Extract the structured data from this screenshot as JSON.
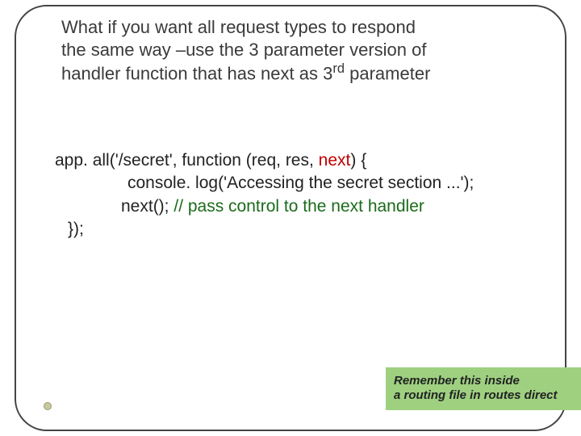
{
  "intro": {
    "t1": "What if you want all request types to respond",
    "t2": "the same way –use the 3 parameter version of",
    "t3_a": "handler function that has next as 3",
    "t3_sup": "rd",
    "t3_b": " parameter"
  },
  "code": {
    "l1a": "app. all('/secret', function (req, res, ",
    "l1_next": "next",
    "l1b": ") {",
    "l2": "console. log('Accessing the secret section ...');",
    "l3a": "next(); ",
    "l3_comment": "// pass control to the next handler",
    "l4": "});"
  },
  "note": {
    "line1": "Remember this inside",
    "line2": "a routing file in routes direct"
  }
}
